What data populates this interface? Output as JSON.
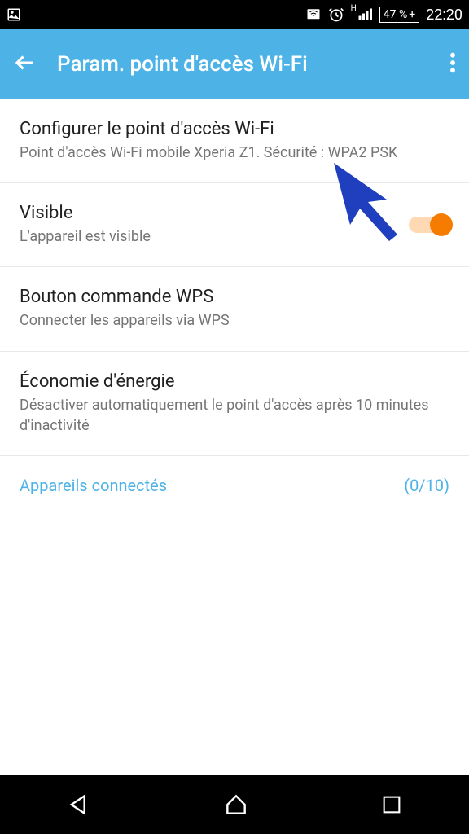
{
  "status": {
    "network_label": "H",
    "battery_percent": "47 %",
    "charging_symbol": "+",
    "time": "22:20"
  },
  "appbar": {
    "title": "Param. point d'accès Wi-Fi"
  },
  "settings": {
    "configure": {
      "title": "Configurer le point d'accès Wi-Fi",
      "subtitle": "Point d'accès Wi-Fi mobile Xperia Z1. Sécurité : WPA2 PSK"
    },
    "visible": {
      "title": "Visible",
      "subtitle": "L'appareil est visible"
    },
    "wps": {
      "title": "Bouton commande WPS",
      "subtitle": "Connecter les appareils via WPS"
    },
    "powersave": {
      "title": "Économie d'énergie",
      "subtitle": "Désactiver automatiquement le point d'accès après 10 minutes d'inactivité"
    }
  },
  "connected": {
    "label": "Appareils connectés",
    "count": "(0/10)"
  }
}
